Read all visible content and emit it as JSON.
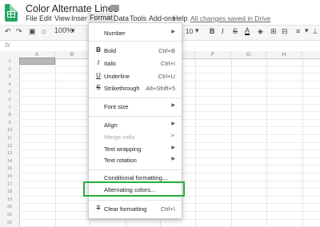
{
  "doc": {
    "title": "Color Alternate Lines",
    "saved": "All changes saved in Drive"
  },
  "menubar": [
    "File",
    "Edit",
    "View",
    "Insert",
    "Format",
    "Data",
    "Tools",
    "Add-ons",
    "Help"
  ],
  "toolbar": {
    "zoom": "100%",
    "font_size": "10",
    "fx": "fx"
  },
  "columns": [
    "A",
    "B",
    "C",
    "D",
    "E",
    "F",
    "G",
    "H"
  ],
  "rows": [
    "1",
    "2",
    "3",
    "4",
    "5",
    "6",
    "7",
    "8",
    "9",
    "10",
    "11",
    "12",
    "13",
    "14",
    "15",
    "16",
    "17",
    "18",
    "19",
    "20",
    "21",
    "22"
  ],
  "format_menu": {
    "number": "Number",
    "bold": "Bold",
    "bold_sc": "Ctrl+B",
    "italic": "Italic",
    "italic_sc": "Ctrl+I",
    "underline": "Underline",
    "underline_sc": "Ctrl+U",
    "strike": "Strikethrough",
    "strike_sc": "Alt+Shift+5",
    "font_size": "Font size",
    "align": "Align",
    "merge": "Merge cells",
    "wrap": "Text wrapping",
    "rotation": "Text rotation",
    "conditional": "Conditional formatting...",
    "alternating": "Alternating colors...",
    "clear": "Clear formatting",
    "clear_sc": "Ctrl+\\"
  },
  "colors": {
    "highlight": "#27ae3c",
    "logo": "#23a566"
  }
}
